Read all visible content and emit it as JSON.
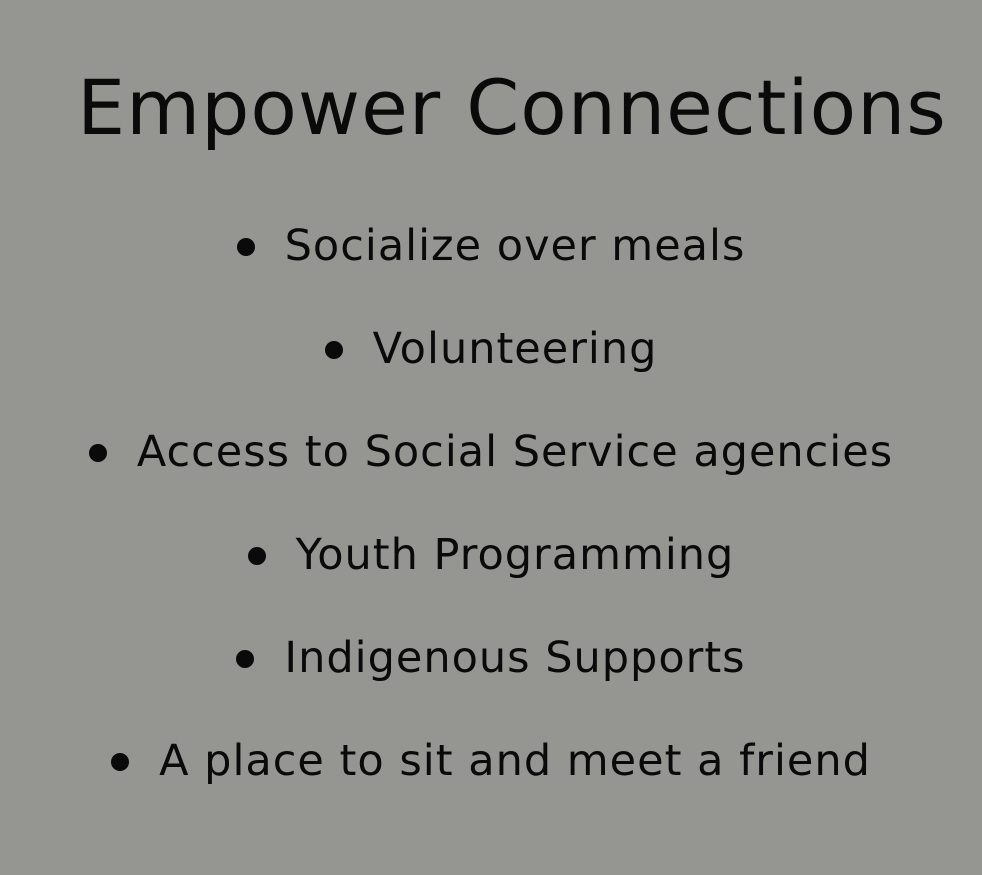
{
  "slide": {
    "title": "Empower Connections",
    "bullets": [
      "Socialize over meals",
      "Volunteering",
      "Access to Social Service agencies",
      "Youth Programming",
      "Indigenous Supports",
      "A place to sit and meet a friend"
    ]
  },
  "colors": {
    "background": "#959591",
    "text": "#0a0a0a"
  }
}
